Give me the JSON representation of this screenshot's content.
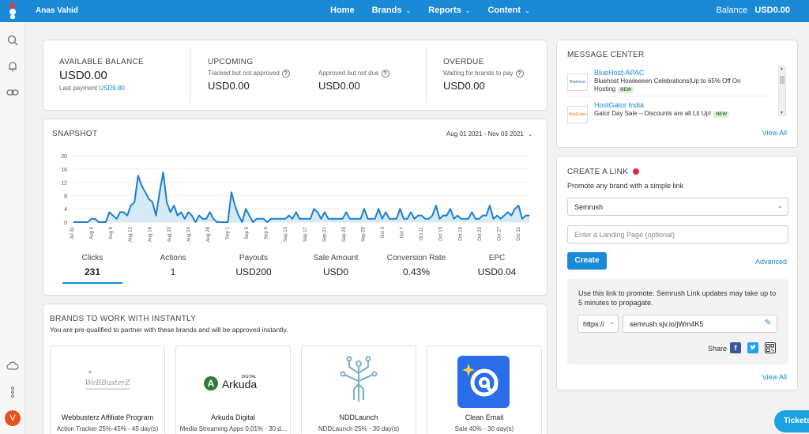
{
  "header": {
    "user_name": "Anas Vahid",
    "nav": [
      {
        "label": "Home",
        "dropdown": false
      },
      {
        "label": "Brands",
        "dropdown": true
      },
      {
        "label": "Reports",
        "dropdown": true
      },
      {
        "label": "Content",
        "dropdown": true
      }
    ],
    "balance_label": "Balance",
    "balance_value": "USD0.00"
  },
  "sidebar": {
    "icons": [
      "search-icon",
      "bell-icon",
      "link-icon",
      "cloud-icon",
      "more-vertical-icon"
    ],
    "avatar_letter": "V"
  },
  "balances": {
    "available_title": "AVAILABLE BALANCE",
    "available_value": "USD0.00",
    "last_payment_label": "Last payment",
    "last_payment_value": "USD9.80",
    "upcoming_title": "UPCOMING",
    "tracked_label": "Tracked but not approved",
    "tracked_value": "USD0.00",
    "approved_label": "Approved but not due",
    "approved_value": "USD0.00",
    "overdue_title": "OVERDUE",
    "waiting_label": "Waiting for brands to pay",
    "waiting_value": "USD0.00"
  },
  "snapshot": {
    "title": "SNAPSHOT",
    "date_range": "Aug 01 2021 - Nov 03 2021",
    "metrics": [
      {
        "label": "Clicks",
        "value": "231"
      },
      {
        "label": "Actions",
        "value": "1"
      },
      {
        "label": "Payouts",
        "value": "USD200"
      },
      {
        "label": "Sale Amount",
        "value": "USD0"
      },
      {
        "label": "Conversion Rate",
        "value": "0.43%"
      },
      {
        "label": "EPC",
        "value": "USD0.04"
      }
    ]
  },
  "chart_data": {
    "type": "area",
    "series": [
      {
        "values": [
          0,
          0,
          0,
          0,
          0,
          1,
          1,
          0,
          0,
          0,
          3,
          2,
          1,
          3,
          3,
          2,
          5,
          6,
          14,
          11,
          9,
          7,
          6,
          2,
          9,
          15,
          6,
          3,
          5,
          2,
          3,
          1,
          3,
          2,
          0,
          2,
          1,
          1,
          3,
          1,
          0,
          0,
          0,
          0,
          9,
          5,
          2,
          0,
          4,
          2,
          0,
          1,
          1,
          1,
          0,
          1,
          1,
          1,
          1,
          1,
          2,
          1,
          3,
          1,
          1,
          1,
          1,
          4,
          3,
          1,
          3,
          1,
          1,
          1,
          1,
          1,
          3,
          1,
          1,
          1,
          1,
          4,
          1,
          1,
          1,
          4,
          1,
          3,
          1,
          1,
          1,
          4,
          1,
          1,
          3,
          1,
          2,
          2,
          1,
          1,
          2,
          5,
          1,
          2,
          2,
          4,
          1,
          2,
          1,
          1,
          1,
          3,
          1,
          1,
          2,
          2,
          5,
          1,
          2,
          1,
          2,
          3,
          2,
          4,
          5,
          1,
          2,
          2
        ]
      }
    ],
    "x_ticks": [
      "Jul 31",
      "Aug 4",
      "Aug 8",
      "Aug 12",
      "Aug 16",
      "Aug 20",
      "Aug 24",
      "Aug 28",
      "Sep 1",
      "Sep 5",
      "Sep 9",
      "Sep 13",
      "Sep 17",
      "Sep 21",
      "Sep 25",
      "Sep 29",
      "Oct 3",
      "Oct 7",
      "Oct 11",
      "Oct 15",
      "Oct 19",
      "Oct 23",
      "Oct 27",
      "Oct 31"
    ],
    "y_ticks": [
      "20",
      "16",
      "12",
      "8",
      "4",
      "0"
    ],
    "ylim": [
      0,
      20
    ],
    "color": "#1a7fd0",
    "fill": "#d6eaf8"
  },
  "brands_section": {
    "title": "BRANDS TO WORK WITH INSTANTLY",
    "subtitle": "You are pre-qualified to partner with these brands and will be approved instantly.",
    "brands": [
      {
        "name": "Webbusterz Affiliate Program",
        "desc": "Action Tracker 25%-45% - 45 day(s)",
        "logo_text": "WeBBusterZ"
      },
      {
        "name": "Arkuda Digital",
        "desc": "Media Streaming Apps 0.01% - 30 d...",
        "logo_text": "Arkuda",
        "logo_small": "DIGITAL"
      },
      {
        "name": "NDDLaunch",
        "desc": "NDDLaunch 25% - 30 day(s)"
      },
      {
        "name": "Clean Email",
        "desc": "Sale 40% - 30 day(s)"
      }
    ]
  },
  "message_center": {
    "title": "MESSAGE CENTER",
    "messages": [
      {
        "brand": "BlueHost-APAC",
        "text": "Bluehost Howleeeen Celebrations|Up to 65% Off On Hosting",
        "badge": "NEW",
        "logo": "Bluehost"
      },
      {
        "brand": "HostGator India",
        "text": "Gator Day Sale – Discounts are all Lit Up!",
        "badge": "NEW",
        "logo": "HostGator"
      }
    ],
    "view_all": "View All"
  },
  "create_link": {
    "title": "CREATE A LINK",
    "subtitle": "Promote any brand with a simple link",
    "brand_selected": "Semrush",
    "landing_placeholder": "Enter a Landing Page (optional)",
    "create_label": "Create",
    "advanced_label": "Advanced",
    "info_text": "Use this link to promote. Semrush Link updates may take up to 5 minutes to propagate.",
    "protocol": "https://",
    "link_value": "semrush.sjv.io/jWm4K5",
    "share_label": "Share",
    "view_all": "View All"
  },
  "tickets_label": "Tickets"
}
